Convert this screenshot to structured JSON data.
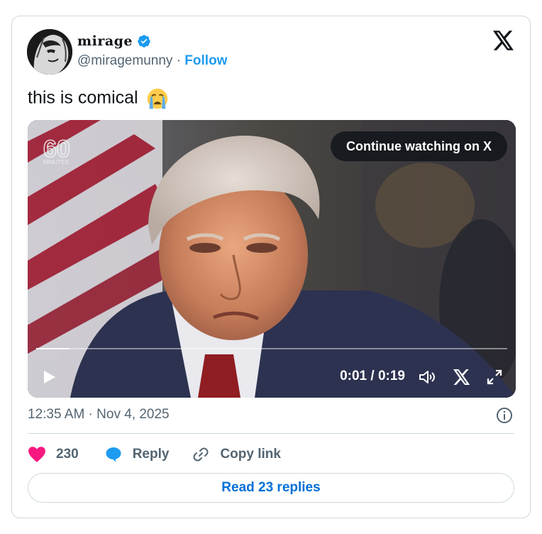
{
  "author": {
    "display_name": "mirage",
    "handle": "@miragemunny",
    "separator": " · ",
    "follow_label": "Follow"
  },
  "tweet": {
    "text": "this is comical"
  },
  "video": {
    "continue_label": "Continue watching on X",
    "watermark": "60 MINUTES",
    "current_time": "0:01",
    "duration": "0:19",
    "time_display": "0:01 / 0:19",
    "progress_fraction": 0.07
  },
  "meta": {
    "timestamp": "12:35 AM · Nov 4, 2025"
  },
  "actions": {
    "like_count": "230",
    "reply_label": "Reply",
    "copy_link_label": "Copy link"
  },
  "footer": {
    "read_replies_label": "Read 23 replies"
  },
  "colors": {
    "accent": "#1d9bf0",
    "link": "#006fd6",
    "like": "#f91880",
    "text_secondary": "#536471",
    "border": "#cfd9de"
  },
  "icons": [
    "verified-badge-icon",
    "x-logo-icon",
    "loudly-crying-face-emoji",
    "play-icon",
    "volume-icon",
    "x-logo-icon",
    "fullscreen-icon",
    "info-icon",
    "heart-icon",
    "speech-bubble-icon",
    "link-icon"
  ]
}
